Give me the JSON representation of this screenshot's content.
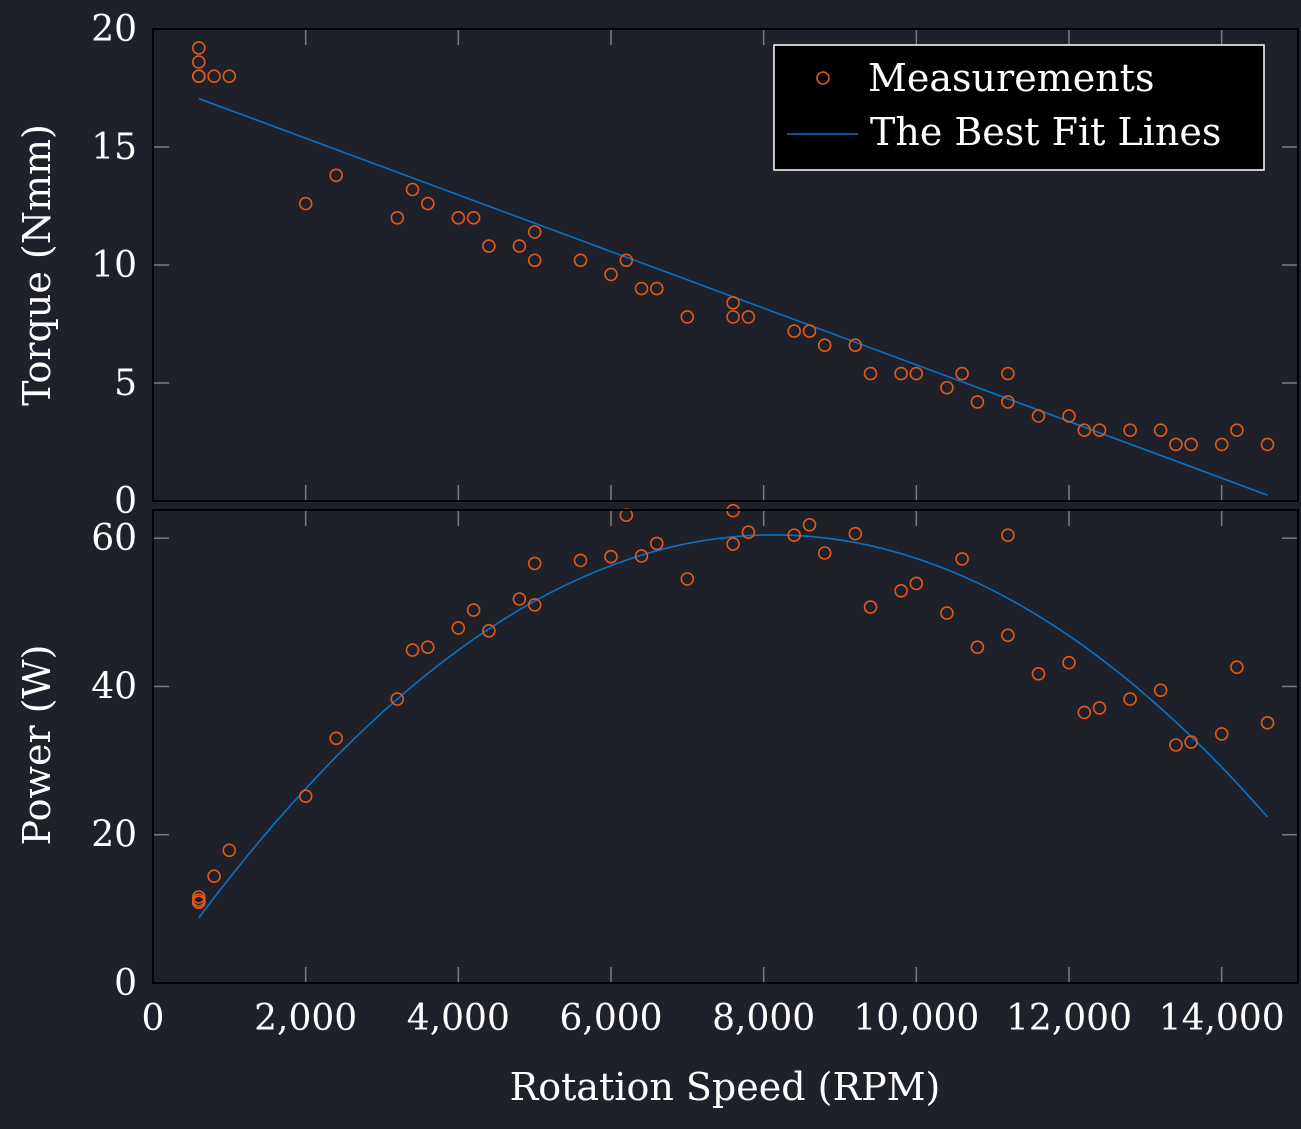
{
  "chart_data": [
    {
      "type": "scatter",
      "panel": "top",
      "ylabel": "Torque (Nmm)",
      "xlabel": "",
      "xlim": [
        0,
        15000
      ],
      "ylim": [
        0,
        20
      ],
      "yticks": [
        0,
        5,
        10,
        15,
        20
      ],
      "ytick_labels": [
        "0",
        "5",
        "10",
        "15",
        "20"
      ],
      "xticks": [
        0,
        2000,
        4000,
        6000,
        8000,
        10000,
        12000,
        14000
      ],
      "grid": false,
      "legend": {
        "placement": "top-right",
        "entries": [
          {
            "label": "Measurements",
            "kind": "marker",
            "color": "#e0581b"
          },
          {
            "label": "The Best Fit Lines",
            "kind": "line",
            "color": "#0a72c4"
          }
        ]
      },
      "series": [
        {
          "name": "Measurements",
          "kind": "scatter",
          "color": "#e0581b",
          "x": [
            600,
            600,
            600,
            600,
            800,
            1000,
            2000,
            2400,
            3200,
            3400,
            3600,
            4000,
            4200,
            4400,
            4800,
            5000,
            5000,
            5600,
            6000,
            6200,
            6400,
            6600,
            7000,
            7600,
            7600,
            7800,
            8400,
            8600,
            8800,
            9200,
            9400,
            9800,
            10000,
            10400,
            10600,
            10800,
            11200,
            11200,
            11600,
            12000,
            12200,
            12400,
            12800,
            13200,
            13400,
            13600,
            14000,
            14200,
            14600
          ],
          "y": [
            19.2,
            18.6,
            18.0,
            18.0,
            18.0,
            18.0,
            12.6,
            13.8,
            12.0,
            13.2,
            12.6,
            12.0,
            12.0,
            10.8,
            10.8,
            11.4,
            10.2,
            10.2,
            9.6,
            10.2,
            9.0,
            9.0,
            7.8,
            8.4,
            7.8,
            7.8,
            7.2,
            7.2,
            6.6,
            6.6,
            5.4,
            5.4,
            5.4,
            4.8,
            5.4,
            4.2,
            5.4,
            4.2,
            3.6,
            3.6,
            3.0,
            3.0,
            3.0,
            3.0,
            2.4,
            2.4,
            2.4,
            3.0,
            2.4
          ]
        },
        {
          "name": "The Best Fit Lines",
          "kind": "line",
          "color": "#0a72c4",
          "fit": "linear",
          "x": [
            600,
            14600
          ],
          "y": [
            17.05,
            0.25
          ]
        }
      ]
    },
    {
      "type": "scatter",
      "panel": "bottom",
      "ylabel": "Power (W)",
      "xlabel": "Rotation Speed (RPM)",
      "xlim": [
        0,
        15000
      ],
      "ylim": [
        0,
        63.8
      ],
      "yticks": [
        0,
        20,
        40,
        60
      ],
      "ytick_labels": [
        "0",
        "20",
        "40",
        "60"
      ],
      "xticks": [
        0,
        2000,
        4000,
        6000,
        8000,
        10000,
        12000,
        14000
      ],
      "xtick_labels": [
        "0",
        "2,000",
        "4,000",
        "6,000",
        "8,000",
        "10,000",
        "12,000",
        "14,000"
      ],
      "grid": false,
      "series": [
        {
          "name": "Measurements",
          "kind": "scatter",
          "color": "#e0581b",
          "x": [
            600,
            600,
            600,
            600,
            800,
            1000,
            2000,
            2400,
            3200,
            3400,
            3600,
            4000,
            4200,
            4400,
            4800,
            5000,
            5000,
            5600,
            6000,
            6200,
            6400,
            6600,
            7000,
            7600,
            7600,
            7800,
            8400,
            8600,
            8800,
            9200,
            9400,
            9800,
            10000,
            10400,
            10600,
            10800,
            11200,
            11200,
            11600,
            12000,
            12200,
            12400,
            12800,
            13200,
            13400,
            13600,
            14000,
            14200,
            14600
          ],
          "y": [
            11.6,
            11.2,
            10.9,
            10.9,
            14.4,
            17.9,
            25.2,
            33.0,
            38.3,
            44.9,
            45.3,
            47.9,
            50.3,
            47.5,
            51.8,
            56.6,
            51.0,
            57.0,
            57.5,
            63.1,
            57.6,
            59.3,
            54.5,
            63.7,
            59.2,
            60.8,
            60.4,
            61.8,
            58.0,
            60.6,
            50.7,
            52.9,
            53.9,
            49.9,
            57.2,
            45.3,
            60.4,
            46.9,
            41.7,
            43.2,
            36.5,
            37.1,
            38.3,
            39.5,
            32.1,
            32.5,
            33.6,
            42.6,
            35.1
          ]
        },
        {
          "name": "The Best Fit Lines",
          "kind": "line",
          "color": "#0a72c4",
          "fit": "quadratic",
          "x_range": [
            600,
            14600
          ],
          "coefficients_per_krpm": {
            "a": 0.246,
            "b": 14.804,
            "c": -0.9101
          }
        }
      ]
    }
  ]
}
